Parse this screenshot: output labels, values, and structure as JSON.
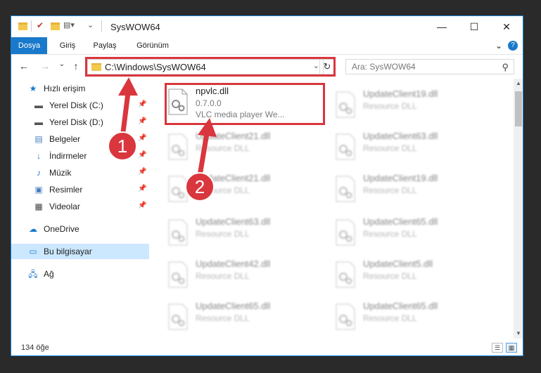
{
  "window": {
    "title": "SysWOW64",
    "minimize_glyph": "—",
    "maximize_glyph": "☐",
    "close_glyph": "✕"
  },
  "ribbon": {
    "tabs": [
      {
        "label": "Dosya",
        "active": true
      },
      {
        "label": "Giriş"
      },
      {
        "label": "Paylaş"
      },
      {
        "label": "Görünüm"
      }
    ],
    "help_glyph": "?",
    "expand_glyph": "⌄"
  },
  "address": {
    "path": "C:\\Windows\\SysWOW64",
    "refresh_glyph": "↻",
    "dropdown_glyph": "⌄"
  },
  "search": {
    "placeholder": "Ara: SysWOW64",
    "icon": "search-icon"
  },
  "nav_buttons": {
    "back": "←",
    "forward": "→",
    "recent": "⌄",
    "up": "↑"
  },
  "sidebar": {
    "items": [
      {
        "label": "Hızlı erişim",
        "icon": "star-icon"
      },
      {
        "label": "Yerel Disk (C:)",
        "icon": "drive-icon",
        "pinned": true
      },
      {
        "label": "Yerel Disk (D:)",
        "icon": "drive-icon",
        "pinned": true
      },
      {
        "label": "Belgeler",
        "icon": "documents-icon",
        "pinned": true
      },
      {
        "label": "İndirmeler",
        "icon": "download-icon",
        "pinned": true
      },
      {
        "label": "Müzik",
        "icon": "music-icon",
        "pinned": true
      },
      {
        "label": "Resimler",
        "icon": "pictures-icon",
        "pinned": true
      },
      {
        "label": "Videolar",
        "icon": "videos-icon",
        "pinned": true
      },
      {
        "label": "OneDrive",
        "icon": "cloud-icon"
      },
      {
        "label": "Bu bilgisayar",
        "icon": "computer-icon",
        "selected": true
      },
      {
        "label": "Ağ",
        "icon": "network-icon"
      }
    ]
  },
  "files": {
    "left": [
      {
        "name": "npvlc.dll",
        "version": "0.7.0.0",
        "description": "VLC media player We...",
        "highlighted": true
      },
      {
        "name": "UpdateClient21.dll",
        "description": "Resource DLL"
      },
      {
        "name": "UpdateClient21.dll",
        "description": "Resource DLL"
      },
      {
        "name": "UpdateClient63.dll",
        "description": "Resource DLL"
      },
      {
        "name": "UpdateClient42.dll",
        "description": "Resource DLL"
      },
      {
        "name": "UpdateClient65.dll",
        "description": "Resource DLL"
      }
    ],
    "right": [
      {
        "name": "UpdateClient19.dll",
        "description": "Resource DLL"
      },
      {
        "name": "UpdateClient63.dll",
        "description": "Resource DLL"
      },
      {
        "name": "UpdateClient19.dll",
        "description": "Resource DLL"
      },
      {
        "name": "UpdateClient65.dll",
        "description": "Resource DLL"
      },
      {
        "name": "UpdateClient5.dll",
        "description": "Resource DLL"
      },
      {
        "name": "UpdateClient65.dll",
        "description": "Resource DLL"
      }
    ]
  },
  "annotations": {
    "step1": "1",
    "step2": "2",
    "color": "#d9363e"
  },
  "status": {
    "item_count": "134 öğe"
  }
}
